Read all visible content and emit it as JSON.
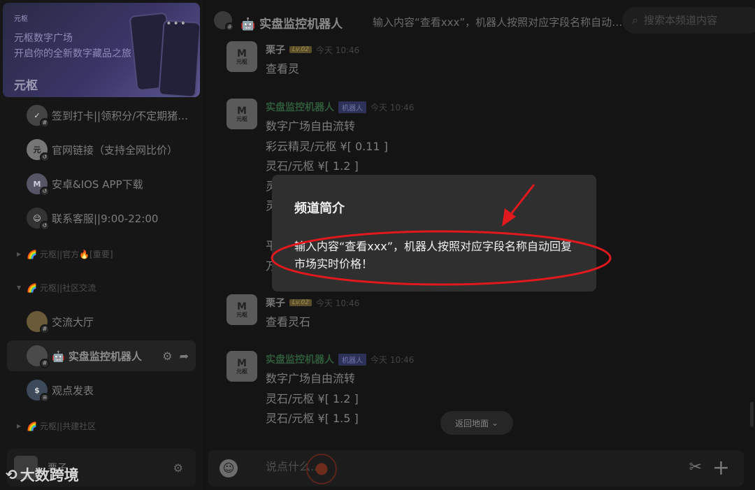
{
  "banner": {
    "logo_text": "元枢",
    "line1": "元枢数字广场",
    "line2": "开启你的全新数字藏品之旅",
    "more": "•••"
  },
  "server": {
    "name": "元枢"
  },
  "channels": [
    {
      "label": "签到打卡||领积分/不定期猪…",
      "icon": "calendar-check-icon",
      "sub": "#"
    },
    {
      "label": "官网链接（支持全网比价）",
      "icon": "yuanshu-logo-icon",
      "sub": "↺"
    },
    {
      "label": "安卓&IOS APP下载",
      "icon": "app-download-icon",
      "sub": "↺"
    },
    {
      "label": "联系客服||9:00-22:00",
      "icon": "support-avatar-icon",
      "sub": "↺"
    }
  ],
  "categories": [
    {
      "label": "元枢||官方🔥[重要]",
      "prefix": "🌈",
      "collapsed": true
    },
    {
      "label": "元枢||社区交流",
      "prefix": "🌈",
      "collapsed": false
    },
    {
      "label": "元枢||共建社区",
      "prefix": "🌈",
      "collapsed": true
    }
  ],
  "community_channels": [
    {
      "label": "交流大厅",
      "sub": "#"
    },
    {
      "label": "🤖 实盘监控机器人",
      "sub": "#",
      "active": true
    },
    {
      "label": "观点发表",
      "sub": "≡"
    }
  ],
  "user": {
    "name": "栗子"
  },
  "watermark": {
    "text": "大数跨境"
  },
  "header": {
    "title": "🤖 实盘监控机器人",
    "description": "输入内容“查看xxx”，机器人按照对应字段名称自动回复市场实时价格！",
    "search_placeholder": "搜索本频道内容"
  },
  "messages": [
    {
      "author": "栗子",
      "level": "Lv.02",
      "time": "今天 10:46",
      "lines": [
        "查看灵"
      ]
    },
    {
      "author": "实盘监控机器人",
      "bot_badge": "机器人",
      "time": "今天 10:46",
      "lines": [
        "数字广场自由流转",
        "彩云精灵/元枢 ¥[ 0.11 ]",
        "灵石/元枢 ¥[ 1.2 ]",
        "灵",
        "灵",
        "",
        "平",
        "万"
      ]
    },
    {
      "author": "栗子",
      "level": "Lv.02",
      "time": "今天 10:46",
      "lines": [
        "查看灵石"
      ]
    },
    {
      "author": "实盘监控机器人",
      "bot_badge": "机器人",
      "time": "今天 10:46",
      "lines": [
        "数字广场自由流转",
        "灵石/元枢 ¥[ 1.2 ]",
        "灵石/元枢 ¥[ 1.5 ]"
      ]
    }
  ],
  "avatar_logo": {
    "mark": "M",
    "text": "元枢"
  },
  "return_button": {
    "label": "返回地面"
  },
  "composer": {
    "placeholder": "说点什么..."
  },
  "dialog": {
    "title": "频道简介",
    "body": "输入内容“查看xxx”，机器人按照对应字段名称自动回复市场实时价格！"
  },
  "colors": {
    "annotation": "#e0191f",
    "bot_name": "#2f5a3a",
    "accent": "#3b3f7a"
  }
}
